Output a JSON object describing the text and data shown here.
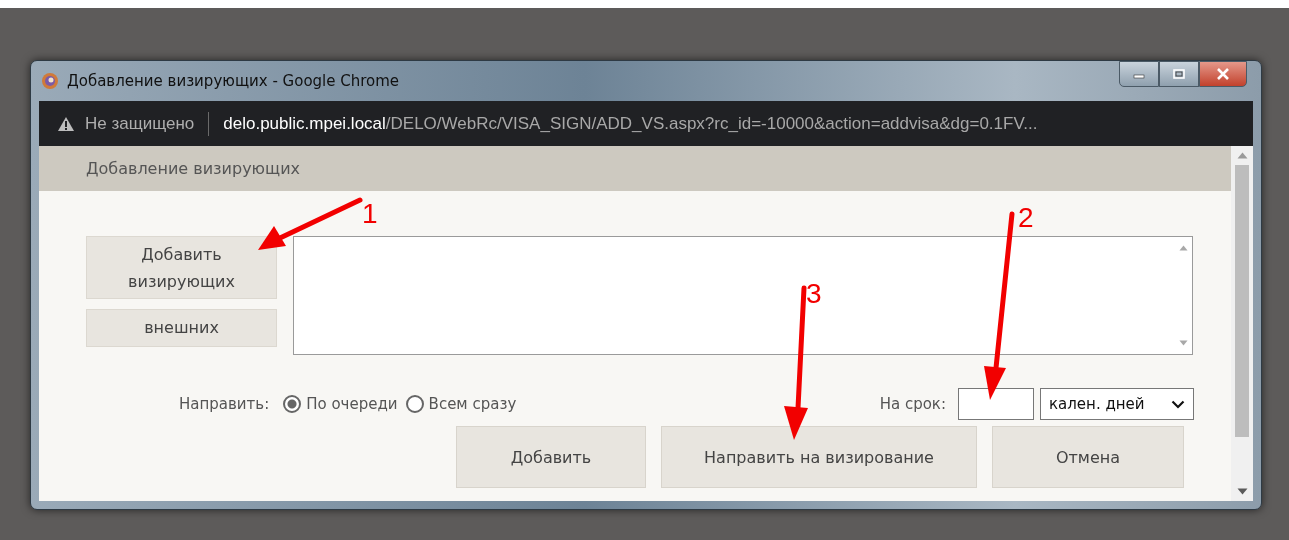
{
  "window": {
    "title": "Добавление визирующих - Google Chrome"
  },
  "address_bar": {
    "security": "Не защищено",
    "host": "delo.public.mpei.local",
    "path": "/DELO/WebRc/VISA_SIGN/ADD_VS.aspx?rc_id=-10000&action=addvisa&dg=0.1FV..."
  },
  "dialog": {
    "header": "Добавление визирующих",
    "side_buttons": [
      "Добавить визирующих",
      "внешних"
    ],
    "send_label": "Направить:",
    "send_options": [
      {
        "label": "По очереди",
        "selected": true
      },
      {
        "label": "Всем сразу",
        "selected": false
      }
    ],
    "term_label": "На срок:",
    "term_unit": "кален. дней",
    "buttons": [
      "Добавить",
      "Направить на визирование",
      "Отмена"
    ]
  },
  "annotations": [
    {
      "label": "1"
    },
    {
      "label": "2"
    },
    {
      "label": "3"
    }
  ]
}
